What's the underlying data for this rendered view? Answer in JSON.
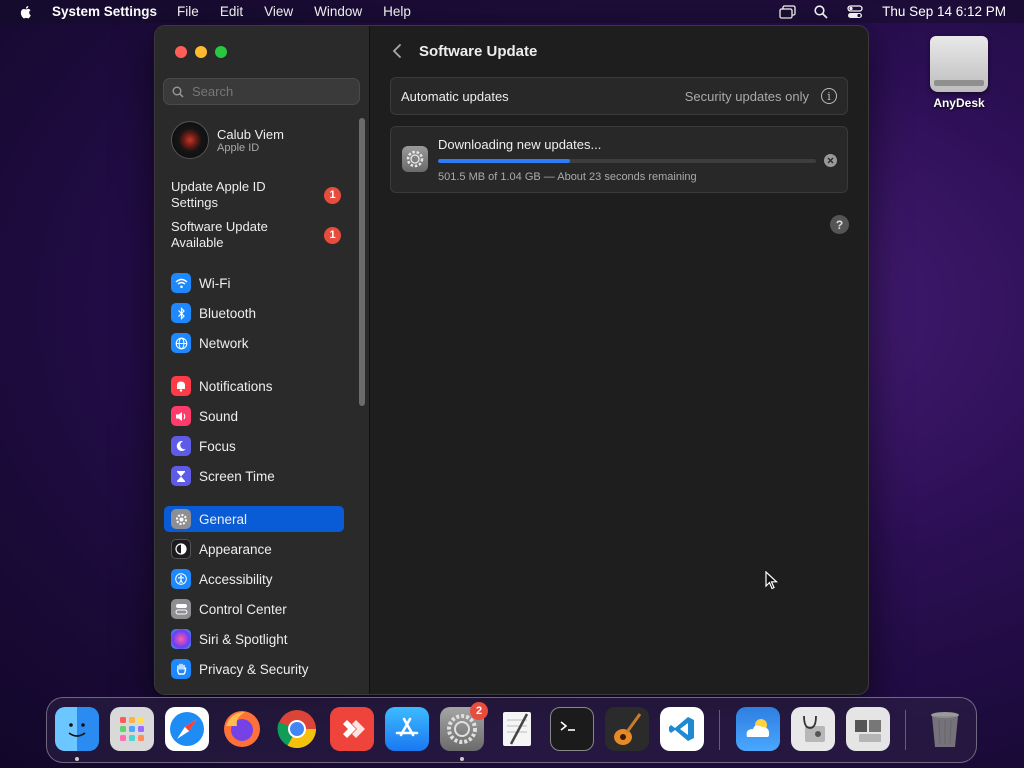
{
  "menubar": {
    "app_name": "System Settings",
    "menus": [
      "File",
      "Edit",
      "View",
      "Window",
      "Help"
    ],
    "clock": "Thu Sep 14  6:12 PM"
  },
  "window": {
    "search_placeholder": "Search",
    "profile": {
      "name": "Calub Viem",
      "subtitle": "Apple ID"
    },
    "alerts": [
      {
        "label": "Update Apple ID Settings",
        "badge": "1"
      },
      {
        "label": "Software Update Available",
        "badge": "1"
      }
    ],
    "sidebar_items": [
      {
        "label": "Wi-Fi",
        "icon": "wifi-icon",
        "color": "#1e88ff"
      },
      {
        "label": "Bluetooth",
        "icon": "bluetooth-icon",
        "color": "#1e88ff"
      },
      {
        "label": "Network",
        "icon": "globe-icon",
        "color": "#1e88ff"
      },
      {
        "label": "Notifications",
        "icon": "bell-icon",
        "color": "#ff3b47"
      },
      {
        "label": "Sound",
        "icon": "speaker-icon",
        "color": "#ff3b6b"
      },
      {
        "label": "Focus",
        "icon": "moon-icon",
        "color": "#5e5ce6"
      },
      {
        "label": "Screen Time",
        "icon": "hourglass-icon",
        "color": "#5e5ce6"
      },
      {
        "label": "General",
        "icon": "gear-icon",
        "color": "#8e8e93",
        "selected": true
      },
      {
        "label": "Appearance",
        "icon": "appearance-icon",
        "color": "#1c1c1e"
      },
      {
        "label": "Accessibility",
        "icon": "accessibility-icon",
        "color": "#1e88ff"
      },
      {
        "label": "Control Center",
        "icon": "toggles-icon",
        "color": "#8e8e93"
      },
      {
        "label": "Siri & Spotlight",
        "icon": "siri-icon",
        "color": "#b04dd8"
      },
      {
        "label": "Privacy & Security",
        "icon": "hand-icon",
        "color": "#1e88ff"
      }
    ],
    "main": {
      "title": "Software Update",
      "automatic_updates_label": "Automatic updates",
      "automatic_updates_value": "Security updates only",
      "download_title": "Downloading new updates...",
      "download_status": "501.5 MB of 1.04 GB — About 23 seconds remaining",
      "download_progress": 0.35
    }
  },
  "desktop": {
    "icon_label": "AnyDesk"
  },
  "dock": {
    "apps": [
      "finder-icon",
      "launchpad-icon",
      "safari-icon",
      "firefox-icon",
      "chrome-icon",
      "anydesk-icon",
      "app-store-icon",
      "system-settings-icon",
      "textedit-icon",
      "terminal-icon",
      "garageband-icon",
      "vscode-icon",
      "weather-icon",
      "disk-utility-icon",
      "boot-camp-icon",
      "trash-icon"
    ],
    "settings_badge": "2"
  }
}
